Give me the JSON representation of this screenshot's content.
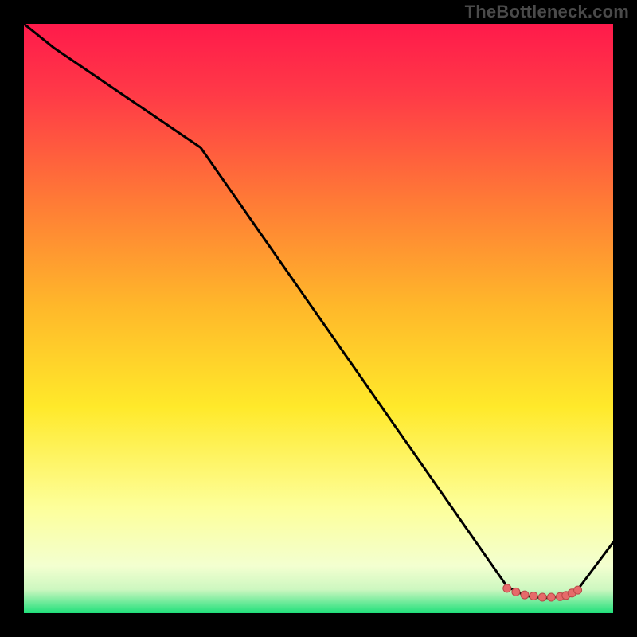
{
  "watermark": "TheBottleneck.com",
  "colors": {
    "background": "#000000",
    "gradient_top": "#ff1a4b",
    "gradient_mid1": "#ff9a2a",
    "gradient_mid2": "#ffe92a",
    "gradient_mid3": "#fdff9a",
    "gradient_bottom": "#1fe07a",
    "curve": "#000000",
    "marker_fill": "#e66a6a",
    "marker_stroke": "#b84848",
    "watermark_text": "#4a4a4a"
  },
  "chart_data": {
    "type": "line",
    "title": "",
    "xlabel": "",
    "ylabel": "",
    "xlim": [
      0,
      100
    ],
    "ylim": [
      0,
      100
    ],
    "series": [
      {
        "name": "curve",
        "x": [
          0,
          5,
          30,
          82,
          85,
          86,
          87,
          88,
          89,
          90,
          91,
          92,
          93,
          94,
          100
        ],
        "y": [
          100,
          96,
          79,
          4.5,
          3,
          2.8,
          2.7,
          2.6,
          2.6,
          2.7,
          2.8,
          3,
          3.5,
          4,
          12
        ]
      }
    ],
    "markers": {
      "name": "flat-points",
      "x": [
        82,
        83.5,
        85,
        86.5,
        88,
        89.5,
        91,
        92,
        93,
        94
      ],
      "y": [
        4.2,
        3.6,
        3.1,
        2.9,
        2.7,
        2.7,
        2.8,
        3.0,
        3.4,
        3.9
      ]
    }
  }
}
